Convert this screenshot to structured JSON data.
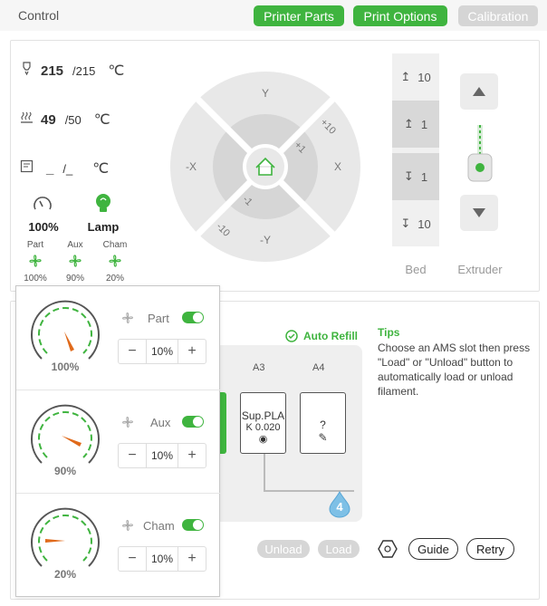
{
  "header": {
    "title": "Control",
    "buttons": [
      {
        "label": "Printer Parts",
        "state": "active"
      },
      {
        "label": "Print Options",
        "state": "active"
      },
      {
        "label": "Calibration",
        "state": "disabled"
      }
    ]
  },
  "temps": {
    "nozzle": {
      "current": "215",
      "target": "/215",
      "unit": "℃",
      "icon": "nozzle-icon"
    },
    "bed": {
      "current": "49",
      "target": "/50",
      "unit": "℃",
      "icon": "heatbed-icon"
    },
    "chamber": {
      "current": "_",
      "target": "/_",
      "unit": "℃",
      "icon": "chamber-icon"
    }
  },
  "speed": {
    "value": "100%",
    "icon": "speedometer-icon"
  },
  "lamp": {
    "label": "Lamp",
    "icon": "lamp-icon"
  },
  "fans_summary": [
    {
      "label": "Part",
      "value": "100%"
    },
    {
      "label": "Aux",
      "value": "90%"
    },
    {
      "label": "Cham",
      "value": "20%"
    }
  ],
  "jog": {
    "outer": {
      "y_plus": "Y",
      "y_minus": "-Y",
      "x_plus": "X",
      "x_minus": "-X",
      "plus10": "+10",
      "minus10": "-10"
    },
    "inner": {
      "plus1": "+1",
      "minus1": "-1"
    },
    "home_icon": "home-icon"
  },
  "bed_steps": {
    "label": "Bed",
    "items": [
      {
        "label": "10",
        "dir": "up"
      },
      {
        "label": "1",
        "dir": "up"
      },
      {
        "label": "1",
        "dir": "down"
      },
      {
        "label": "10",
        "dir": "down"
      }
    ]
  },
  "extruder": {
    "label": "Extruder"
  },
  "ams": {
    "auto_refill": "Auto Refill",
    "slots": [
      {
        "id": "A3",
        "name": "Sup.PLA",
        "k": "K 0.020"
      },
      {
        "id": "A4",
        "name": "?",
        "k": ""
      }
    ],
    "badge": "4",
    "unload": "Unload",
    "load": "Load",
    "guide": "Guide",
    "retry": "Retry"
  },
  "tips": {
    "title": "Tips",
    "body": "Choose an AMS slot then press \"Load\" or \"Unload\" button to automatically load or unload filament."
  },
  "fan_popup": [
    {
      "name": "Part",
      "value": "10%",
      "gauge": "100%",
      "enabled": true
    },
    {
      "name": "Aux",
      "value": "10%",
      "gauge": "90%",
      "enabled": true
    },
    {
      "name": "Cham",
      "value": "10%",
      "gauge": "20%",
      "enabled": true
    }
  ],
  "colors": {
    "accent": "#3fb43f",
    "ams_badge": "#5aa7d6"
  }
}
